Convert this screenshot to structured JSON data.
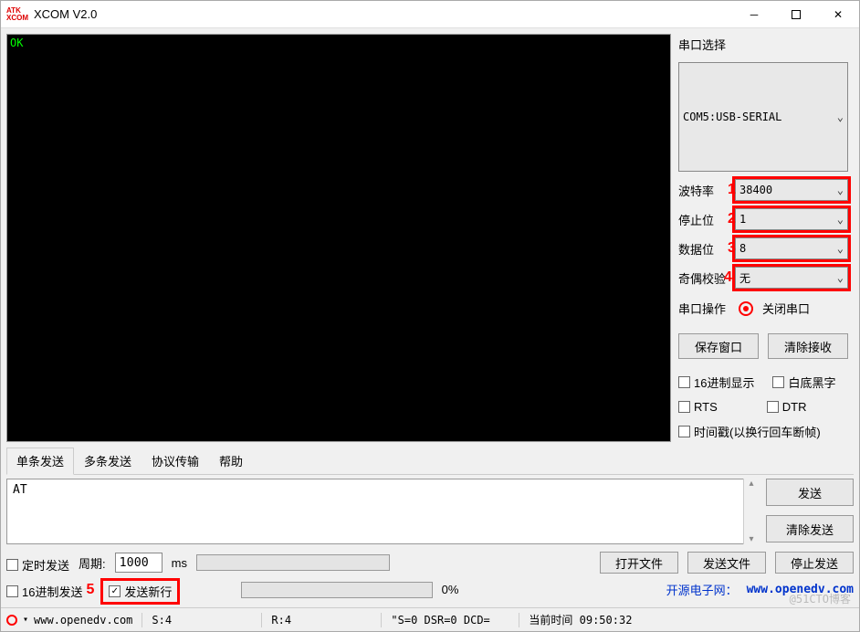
{
  "window": {
    "title": "XCOM V2.0"
  },
  "terminal": {
    "output": "OK"
  },
  "side": {
    "port_label": "串口选择",
    "port_value": "COM5:USB-SERIAL",
    "baud_label": "波特率",
    "baud_value": "38400",
    "stop_label": "停止位",
    "stop_value": "1",
    "data_label": "数据位",
    "data_value": "8",
    "parity_label": "奇偶校验",
    "parity_value": "无",
    "op_label": "串口操作",
    "close_btn": "关闭串口",
    "save_btn": "保存窗口",
    "clear_btn": "清除接收",
    "hex_disp": "16进制显示",
    "white_bg": "白底黑字",
    "rts": "RTS",
    "dtr": "DTR",
    "timestamp": "时间戳(以换行回车断帧)",
    "annot1": "1",
    "annot2": "2",
    "annot3": "3",
    "annot4": "4"
  },
  "tabs": {
    "t1": "单条发送",
    "t2": "多条发送",
    "t3": "协议传输",
    "t4": "帮助"
  },
  "send": {
    "input": "AT",
    "send_btn": "发送",
    "clear_send_btn": "清除发送"
  },
  "opts": {
    "timed": "定时发送",
    "period_label": "周期:",
    "period_value": "1000",
    "ms": "ms",
    "open_file": "打开文件",
    "send_file": "发送文件",
    "stop_send": "停止发送",
    "hex_send": "16进制发送",
    "annot5": "5",
    "newline": "发送新行",
    "percent": "0%",
    "link_pre": "开源电子网：",
    "link": "www.openedv.com"
  },
  "status": {
    "url": "www.openedv.com",
    "s": "S:4",
    "r": "R:4",
    "ctl": "\"S=0 DSR=0 DCD=",
    "time_label": "当前时间 09:50:32"
  },
  "watermark": "@51CTO博客"
}
